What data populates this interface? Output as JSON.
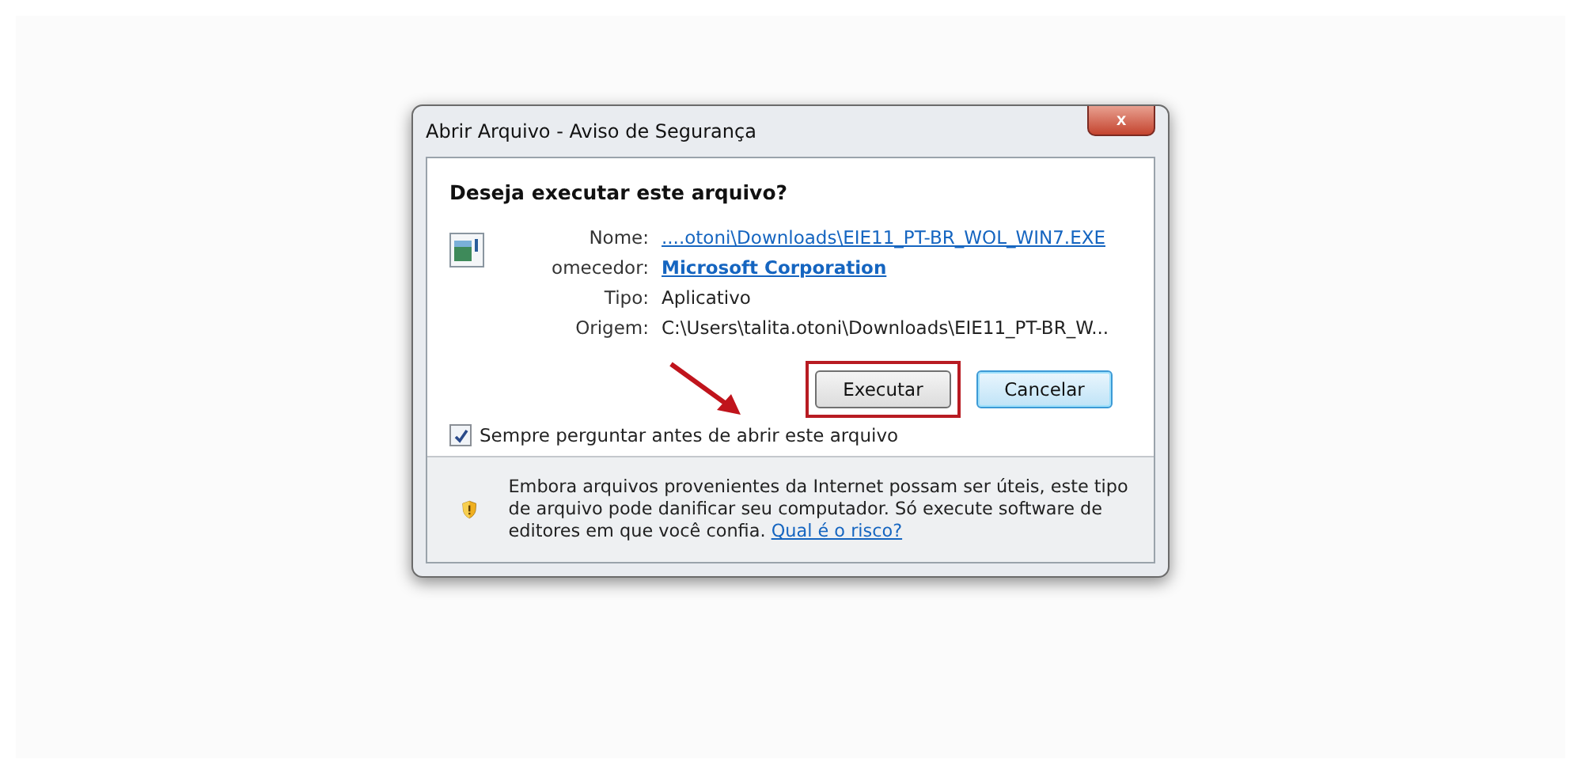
{
  "window": {
    "title": "Abrir Arquivo - Aviso de Segurança",
    "close": "x"
  },
  "question": "Deseja executar este arquivo?",
  "fields": [
    {
      "label": "Nome:",
      "value": "....otoni\\Downloads\\EIE11_PT-BR_WOL_WIN7.EXE",
      "kind": "link"
    },
    {
      "label": "omecedor:",
      "value": "Microsoft Corporation",
      "kind": "bold-link"
    },
    {
      "label": "Tipo:",
      "value": "Aplicativo",
      "kind": "text"
    },
    {
      "label": "Origem:",
      "value": "C:\\Users\\talita.otoni\\Downloads\\EIE11_PT-BR_W...",
      "kind": "text"
    }
  ],
  "buttons": [
    {
      "label": "Executar",
      "highlighted": true,
      "default": false
    },
    {
      "label": "Cancelar",
      "highlighted": false,
      "default": true
    }
  ],
  "checkbox": {
    "label": "Sempre perguntar antes de abrir este arquivo",
    "checked": true
  },
  "warning": {
    "text": "Embora arquivos provenientes da Internet possam ser úteis, este tipo de arquivo pode danificar seu computador. Só execute software de editores em que você confia.",
    "link": "Qual é o risco?"
  }
}
